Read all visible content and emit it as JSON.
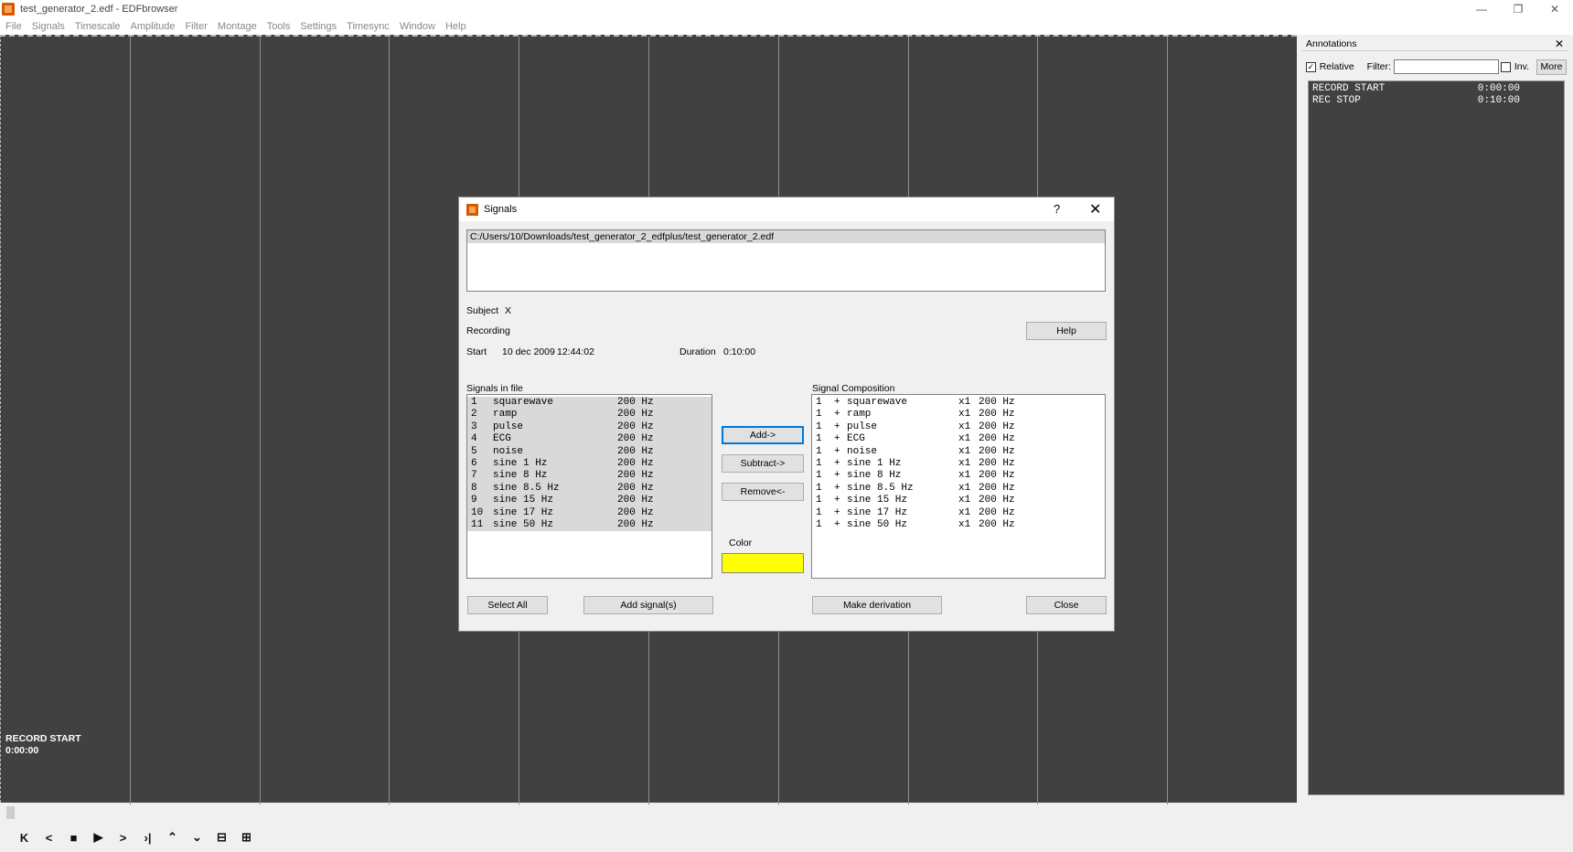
{
  "window": {
    "title": "test_generator_2.edf - EDFbrowser",
    "controls": [
      "—",
      "❐",
      "✕"
    ]
  },
  "menu": [
    "File",
    "Signals",
    "Timescale",
    "Amplitude",
    "Filter",
    "Montage",
    "Tools",
    "Settings",
    "Timesync",
    "Window",
    "Help"
  ],
  "canvas": {
    "annotation_label": "RECORD START",
    "annotation_time": "0:00:00"
  },
  "annotations_panel": {
    "title": "Annotations",
    "close": "✕",
    "relative_label": "Relative",
    "relative_checked": true,
    "filter_label": "Filter:",
    "filter_value": "",
    "inv_label": "Inv.",
    "inv_checked": false,
    "more_label": "More",
    "items": [
      {
        "text": "RECORD START",
        "time": "0:00:00"
      },
      {
        "text": "REC STOP",
        "time": "0:10:00"
      }
    ]
  },
  "toolbar": {
    "buttons": [
      {
        "name": "first-icon",
        "glyph": "K"
      },
      {
        "name": "prev-icon",
        "glyph": "<"
      },
      {
        "name": "stop-icon",
        "glyph": "■"
      },
      {
        "name": "play-icon",
        "glyph": "▶"
      },
      {
        "name": "next-icon",
        "glyph": ">"
      },
      {
        "name": "last-icon",
        "glyph": "›|"
      },
      {
        "name": "up-icon",
        "glyph": "⌃"
      },
      {
        "name": "down-icon",
        "glyph": "⌄"
      },
      {
        "name": "minus-icon",
        "glyph": "⊟"
      },
      {
        "name": "plus-icon",
        "glyph": "⊞"
      }
    ]
  },
  "dialog": {
    "title": "Signals",
    "help_glyph": "?",
    "close_glyph": "✕",
    "file_path": "C:/Users/10/Downloads/test_generator_2_edfplus/test_generator_2.edf",
    "subject_label": "Subject",
    "subject_value": "X",
    "recording_label": "Recording",
    "start_label": "Start",
    "start_date": "10 dec 2009",
    "start_time": "12:44:02",
    "duration_label": "Duration",
    "duration_value": "0:10:00",
    "help_button": "Help",
    "signals_in_file_label": "Signals in file",
    "signal_composition_label": "Signal Composition",
    "add_button": "Add->",
    "subtract_button": "Subtract->",
    "remove_button": "Remove<-",
    "color_label": "Color",
    "color_value": "#ffff00",
    "select_all_button": "Select All",
    "add_signals_button": "Add signal(s)",
    "make_derivation_button": "Make derivation",
    "close_button": "Close",
    "signals": [
      {
        "num": "1",
        "name": "squarewave",
        "rate": "200 Hz"
      },
      {
        "num": "2",
        "name": "ramp",
        "rate": "200 Hz"
      },
      {
        "num": "3",
        "name": "pulse",
        "rate": "200 Hz"
      },
      {
        "num": "4",
        "name": "ECG",
        "rate": "200 Hz"
      },
      {
        "num": "5",
        "name": "noise",
        "rate": "200 Hz"
      },
      {
        "num": "6",
        "name": "sine 1 Hz",
        "rate": "200 Hz"
      },
      {
        "num": "7",
        "name": "sine 8 Hz",
        "rate": "200 Hz"
      },
      {
        "num": "8",
        "name": "sine 8.5 Hz",
        "rate": "200 Hz"
      },
      {
        "num": "9",
        "name": "sine 15 Hz",
        "rate": "200 Hz"
      },
      {
        "num": "10",
        "name": "sine 17 Hz",
        "rate": "200 Hz"
      },
      {
        "num": "11",
        "name": "sine 50 Hz",
        "rate": "200 Hz"
      }
    ],
    "composition": [
      {
        "num": "1",
        "sign": "+",
        "name": "squarewave",
        "factor": "x1",
        "rate": "200 Hz"
      },
      {
        "num": "1",
        "sign": "+",
        "name": "ramp",
        "factor": "x1",
        "rate": "200 Hz"
      },
      {
        "num": "1",
        "sign": "+",
        "name": "pulse",
        "factor": "x1",
        "rate": "200 Hz"
      },
      {
        "num": "1",
        "sign": "+",
        "name": "ECG",
        "factor": "x1",
        "rate": "200 Hz"
      },
      {
        "num": "1",
        "sign": "+",
        "name": "noise",
        "factor": "x1",
        "rate": "200 Hz"
      },
      {
        "num": "1",
        "sign": "+",
        "name": "sine 1 Hz",
        "factor": "x1",
        "rate": "200 Hz"
      },
      {
        "num": "1",
        "sign": "+",
        "name": "sine 8 Hz",
        "factor": "x1",
        "rate": "200 Hz"
      },
      {
        "num": "1",
        "sign": "+",
        "name": "sine 8.5 Hz",
        "factor": "x1",
        "rate": "200 Hz"
      },
      {
        "num": "1",
        "sign": "+",
        "name": "sine 15 Hz",
        "factor": "x1",
        "rate": "200 Hz"
      },
      {
        "num": "1",
        "sign": "+",
        "name": "sine 17 Hz",
        "factor": "x1",
        "rate": "200 Hz"
      },
      {
        "num": "1",
        "sign": "+",
        "name": "sine 50 Hz",
        "factor": "x1",
        "rate": "200 Hz"
      }
    ]
  }
}
